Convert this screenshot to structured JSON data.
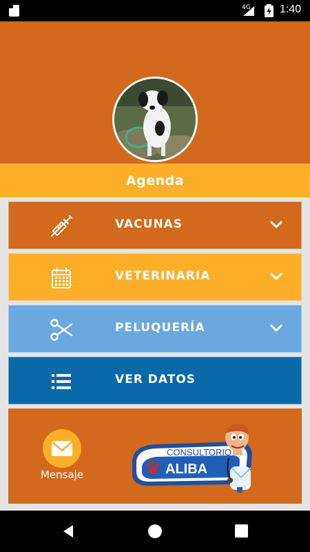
{
  "status_bar": {
    "network": "4G",
    "time": "1:40"
  },
  "header": {
    "avatar_alt": "pet photo"
  },
  "section": {
    "title": "Agenda"
  },
  "menu": [
    {
      "label": "VACUNAS",
      "icon": "syringe-icon",
      "color": "#d2691d",
      "expandable": true
    },
    {
      "label": "VETERINARIA",
      "icon": "calendar-icon",
      "color": "#fdaf2a",
      "expandable": true
    },
    {
      "label": "PELUQUERÍA",
      "icon": "scissors-icon",
      "color": "#6aa8df",
      "expandable": true
    },
    {
      "label": "VER DATOS",
      "icon": "list-icon",
      "color": "#0a69a8",
      "expandable": false
    }
  ],
  "footer_panel": {
    "message_label": "Mensaje",
    "logo_top": "CONSULTORIO",
    "logo_bottom": "ALIBA"
  },
  "colors": {
    "header_bg": "#d2691d",
    "accent": "#fdaf2a",
    "page_bg": "#e4e4e4"
  }
}
